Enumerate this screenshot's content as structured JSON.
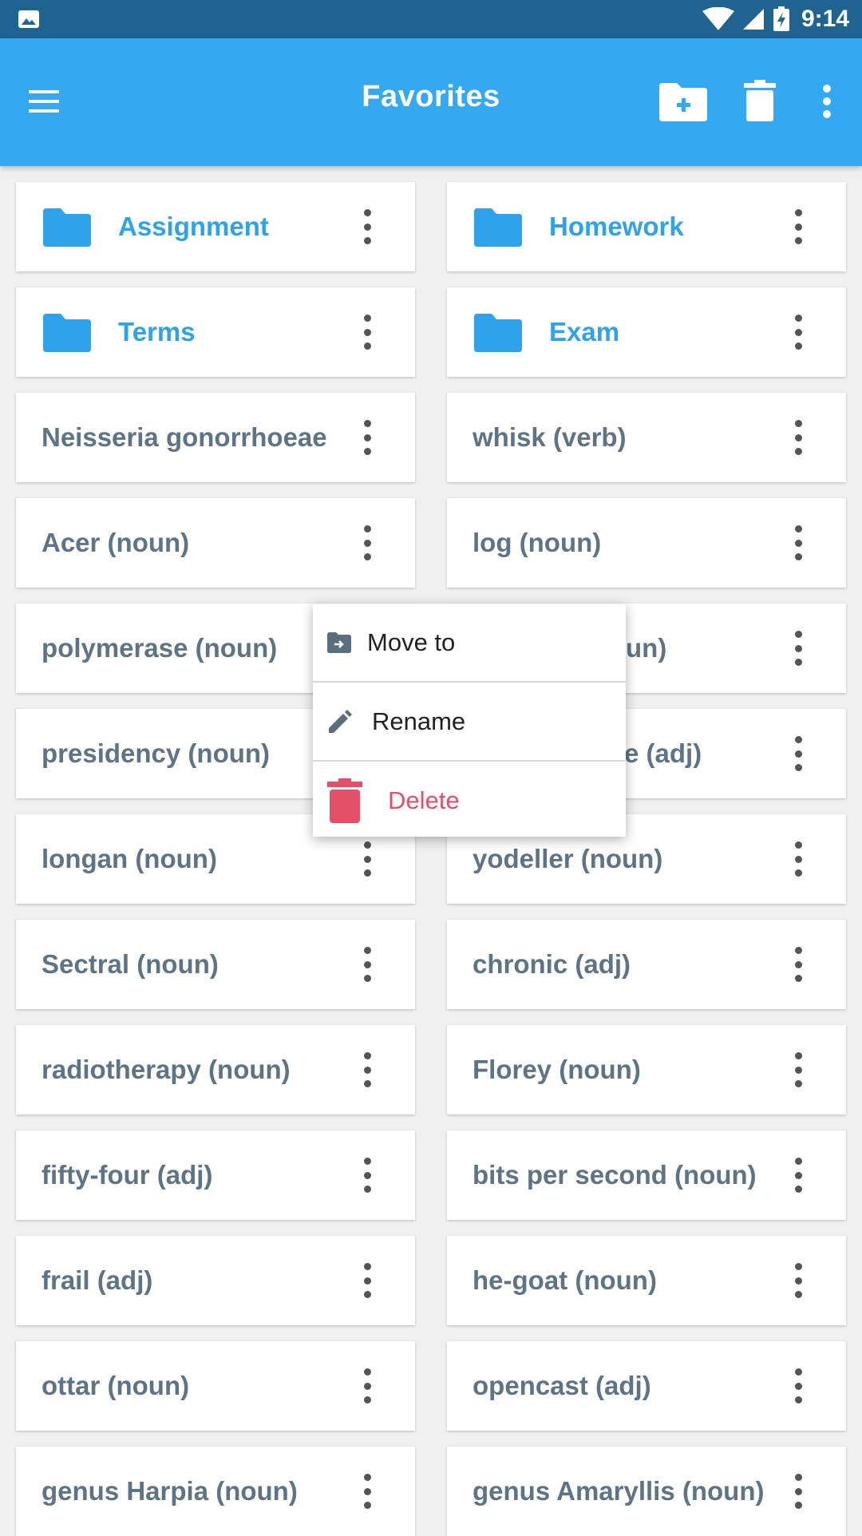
{
  "status_bar": {
    "time": "9:14"
  },
  "app_bar": {
    "title": "Favorites",
    "menu_icon": "hamburger-menu-icon",
    "actions": [
      "new-folder-icon",
      "trash-icon",
      "more-vert-icon"
    ]
  },
  "colors": {
    "app_bar": "#34a9f1",
    "status_bar": "#1f6391",
    "folder_accent": "#2ea3ec",
    "word_text": "#5e7485",
    "delete_red": "#e35068"
  },
  "folders": [
    "Assignment",
    "Homework",
    "Terms",
    "Exam"
  ],
  "items": [
    "Neisseria gonorrhoeae",
    "whisk (verb)",
    "Acer (noun)",
    "log (noun)",
    "polymerase (noun)",
    "un)",
    "presidency (noun)",
    "e (adj)",
    "longan (noun)",
    "yodeller (noun)",
    "Sectral (noun)",
    "chronic (adj)",
    "radiotherapy (noun)",
    "Florey (noun)",
    "fifty-four (adj)",
    "bits per second (noun)",
    "frail (adj)",
    "he-goat (noun)",
    "ottar (noun)",
    "opencast (adj)",
    "genus Harpia (noun)",
    "genus Amaryllis (noun)"
  ],
  "context_menu": {
    "items": [
      {
        "label": "Move to",
        "icon": "move-to-icon"
      },
      {
        "label": "Rename",
        "icon": "pencil-icon"
      },
      {
        "label": "Delete",
        "icon": "trash-icon"
      }
    ]
  }
}
